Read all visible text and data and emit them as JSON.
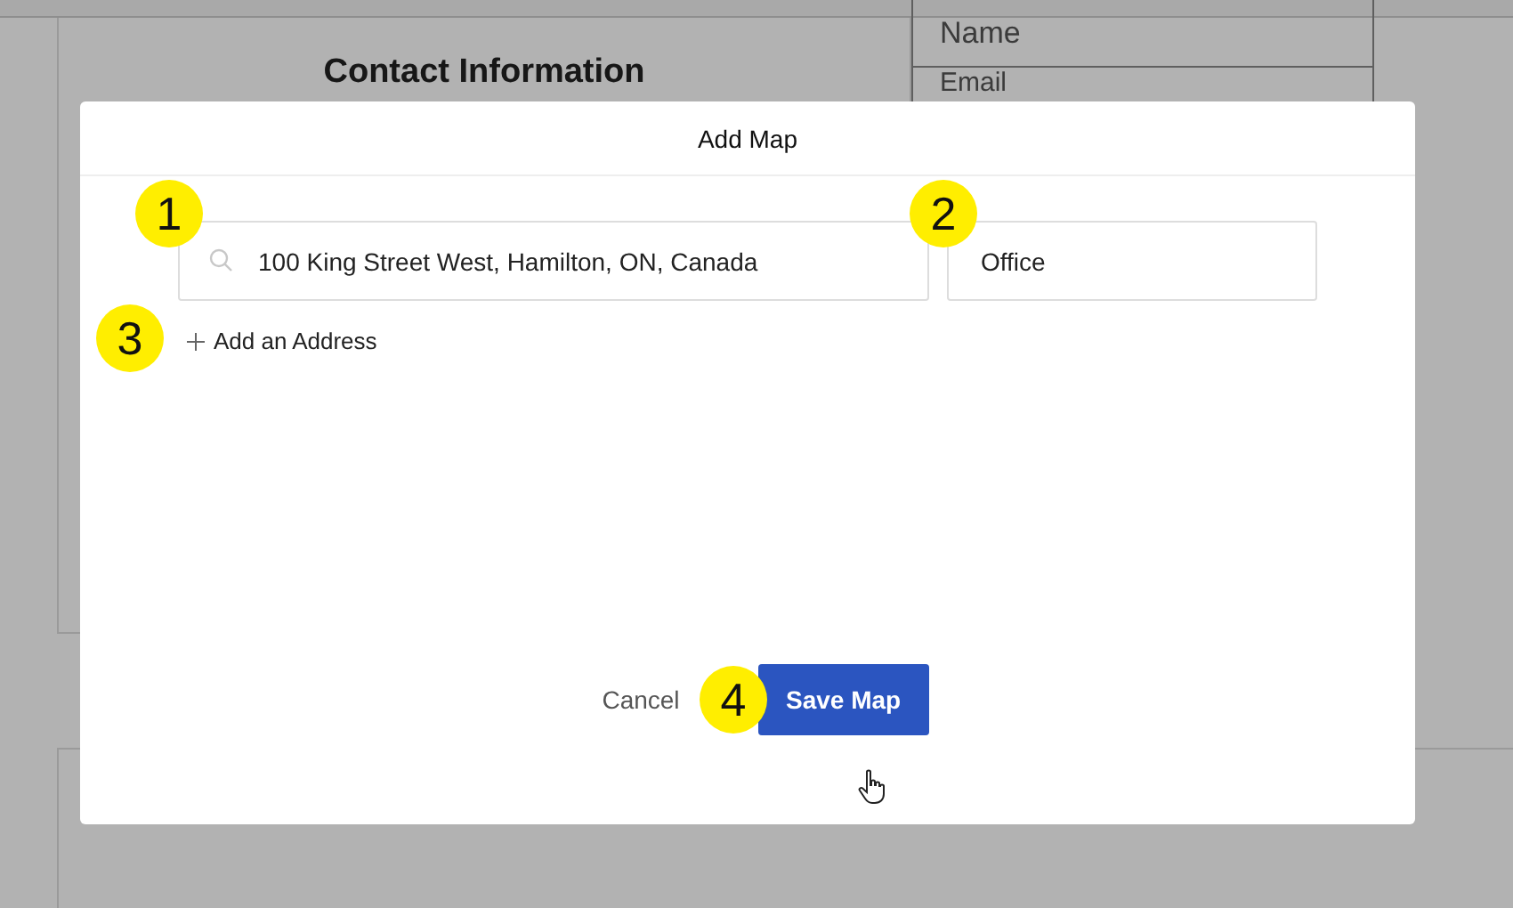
{
  "background": {
    "heading": "Contact Information",
    "fields": [
      "Name",
      "Email"
    ]
  },
  "dialog": {
    "title": "Add Map",
    "address": {
      "value": "100 King Street West, Hamilton, ON, Canada"
    },
    "label": {
      "value": "Office"
    },
    "add_link": "Add an Address",
    "buttons": [
      {
        "kind": "secondary",
        "label": "Cancel"
      },
      {
        "kind": "primary",
        "label": "Save Map"
      }
    ]
  },
  "callouts": [
    "1",
    "2",
    "3",
    "4"
  ]
}
